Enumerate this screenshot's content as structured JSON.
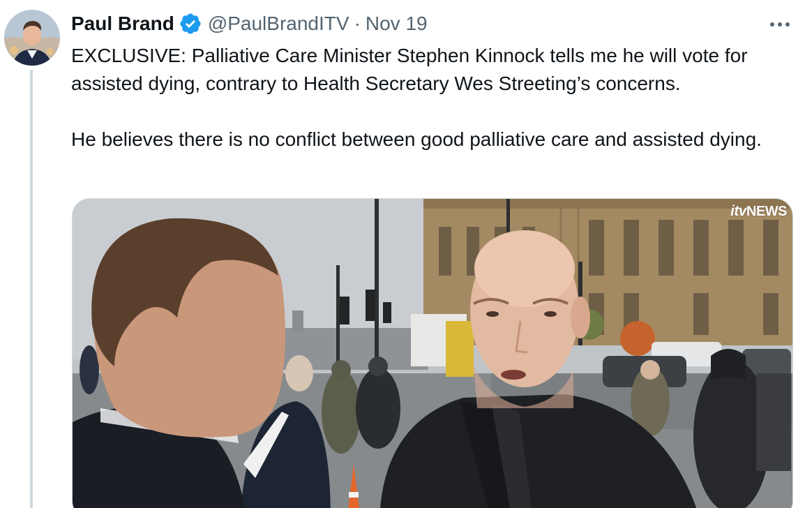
{
  "author": {
    "name": "Paul Brand",
    "handle": "@PaulBrandITV",
    "separator": "·",
    "date": "Nov 19",
    "verified": true,
    "verified_color": "#1d9bf0"
  },
  "tweet": {
    "paragraphs": [
      "EXCLUSIVE: Palliative Care Minister Stephen Kinnock tells me he will vote for assisted dying, contrary to Health Secretary Wes Streeting’s concerns.",
      "He believes there is no conflict between good palliative care and assisted dying."
    ]
  },
  "media": {
    "logo_prefix": "itv",
    "logo_suffix": "NEWS"
  },
  "icons": {
    "more": "more-horizontal-icon",
    "verified": "verified-badge-icon"
  },
  "colors": {
    "text": "#0f1419",
    "secondary": "#536471",
    "border": "#cfd9de"
  }
}
